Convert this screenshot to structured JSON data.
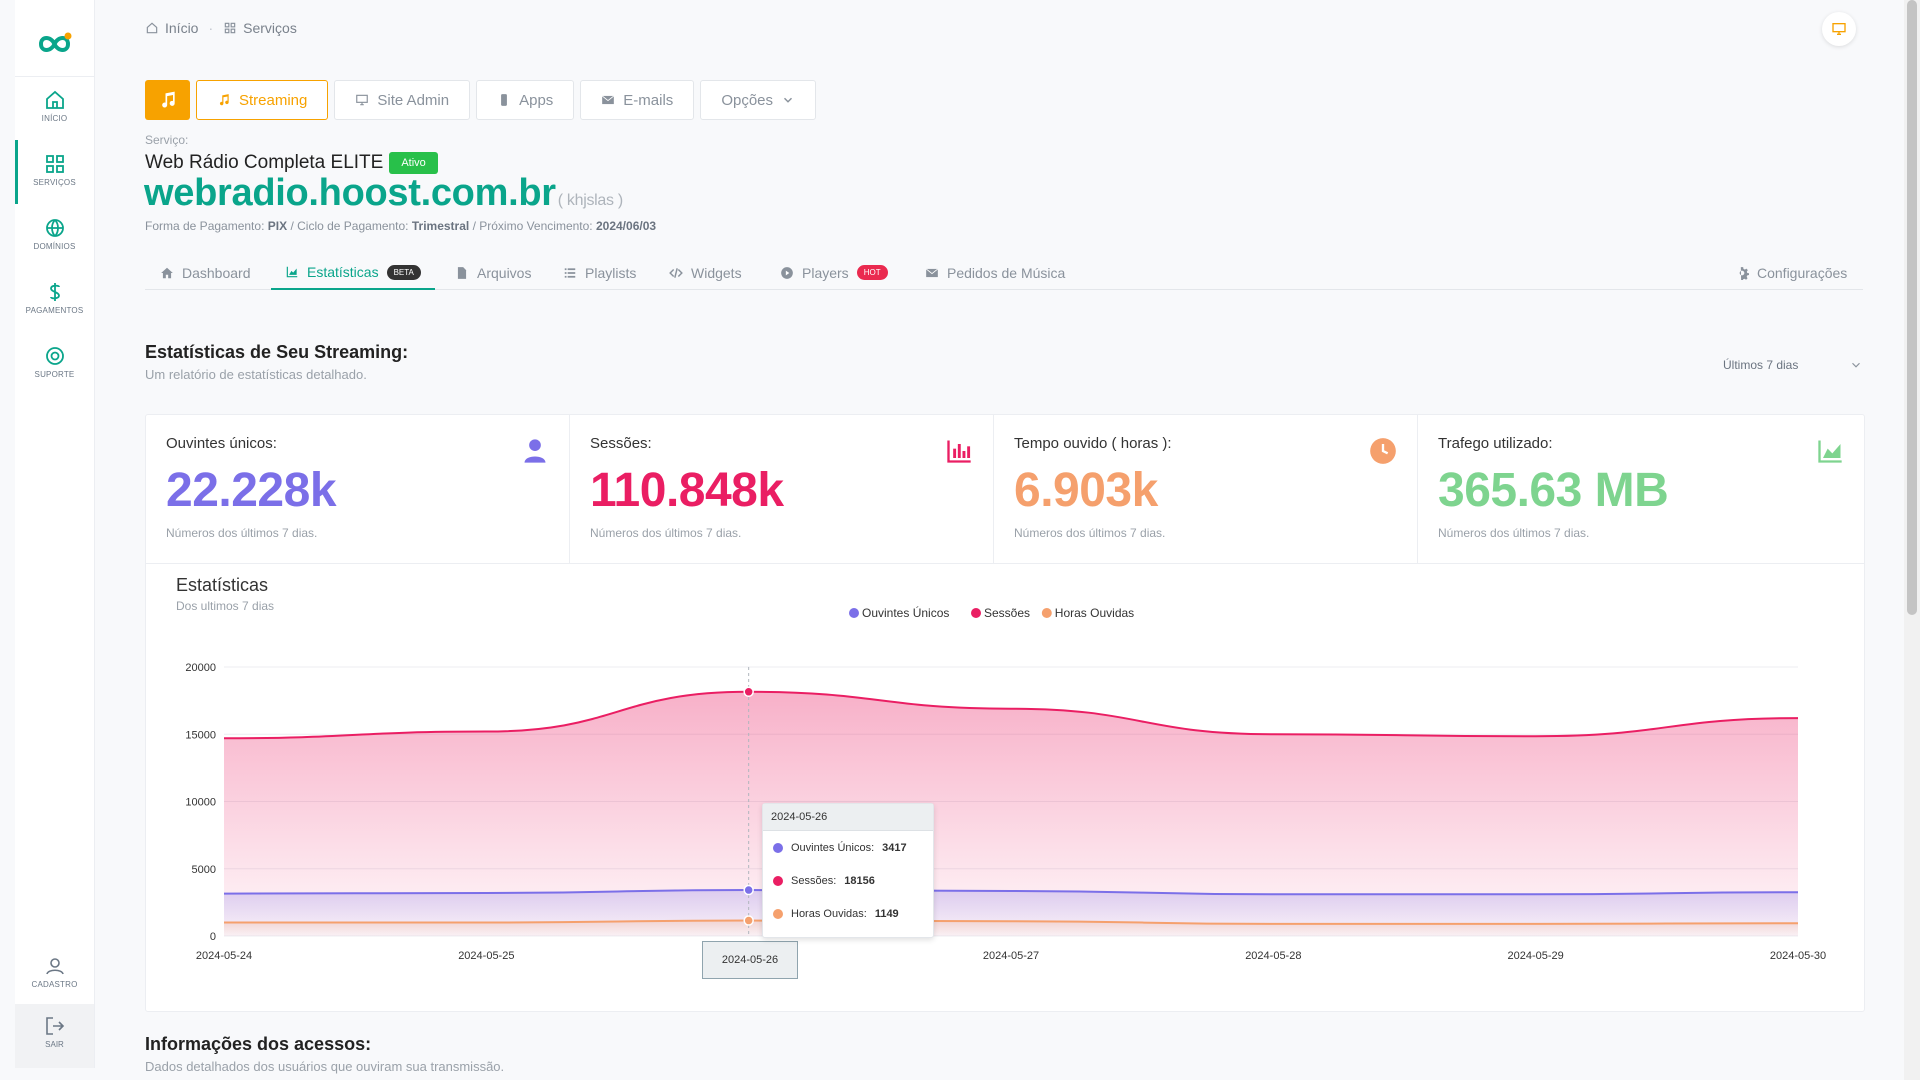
{
  "sidebar": {
    "items": [
      {
        "label": "INÍCIO",
        "icon": "home-icon"
      },
      {
        "label": "SERVIÇOS",
        "icon": "grid-icon",
        "active": true
      },
      {
        "label": "DOMÍNIOS",
        "icon": "globe-icon"
      },
      {
        "label": "PAGAMENTOS",
        "icon": "dollar-icon"
      },
      {
        "label": "SUPORTE",
        "icon": "lifebuoy-icon"
      }
    ],
    "cadastro_label": "CADASTRO",
    "sair_label": "SAIR"
  },
  "breadcrumb": {
    "home": "Início",
    "current": "Serviços"
  },
  "service_tabs": {
    "streaming": "Streaming",
    "site_admin": "Site Admin",
    "apps": "Apps",
    "emails": "E-mails",
    "opcoes": "Opções"
  },
  "service": {
    "label": "Serviço:",
    "name": "Web Rádio Completa ELITE",
    "status": "Ativo",
    "domain": "webradio.hoost.com.br",
    "username": "( khjslas )",
    "payment_label": "Forma de Pagamento:",
    "payment_value": "PIX",
    "cycle_label": "/ Ciclo de Pagamento:",
    "cycle_value": "Trimestral",
    "due_label": "/ Próximo Vencimento:",
    "due_value": "2024/06/03"
  },
  "sub_tabs": {
    "dashboard": "Dashboard",
    "estatisticas": "Estatísticas",
    "beta": "BETA",
    "arquivos": "Arquivos",
    "playlists": "Playlists",
    "widgets": "Widgets",
    "players": "Players",
    "hot": "HOT",
    "pedidos": "Pedidos de Música",
    "configuracoes": "Configurações"
  },
  "stats": {
    "title": "Estatísticas de Seu Streaming:",
    "subtitle": "Um relatório de estatísticas detalhado.",
    "period": "Últimos 7 dias"
  },
  "kpis": [
    {
      "title": "Ouvintes únicos:",
      "value": "22.228k",
      "note": "Números dos últimos 7 dias.",
      "color": "#7b6fe8",
      "icon": "user-icon"
    },
    {
      "title": "Sessões:",
      "value": "110.848k",
      "note": "Números dos últimos 7 dias.",
      "color": "#ea1e63",
      "icon": "bar-chart-icon"
    },
    {
      "title": "Tempo ouvido ( horas ):",
      "value": "6.903k",
      "note": "Números dos últimos 7 dias.",
      "color": "#f5a06d",
      "icon": "clock-icon"
    },
    {
      "title": "Trafego utilizado:",
      "value": "365.63 MB",
      "note": "Números dos últimos 7 dias.",
      "color": "#7ed48f",
      "icon": "area-chart-icon"
    }
  ],
  "chart_header": {
    "title": "Estatísticas",
    "subtitle": "Dos ultimos 7 dias"
  },
  "chart_data": {
    "type": "area",
    "x": [
      "2024-05-24",
      "2024-05-25",
      "2024-05-26",
      "2024-05-27",
      "2024-05-28",
      "2024-05-29",
      "2024-05-30"
    ],
    "series": [
      {
        "name": "Ouvintes Únicos",
        "color": "#7b6fe8",
        "values": [
          3150,
          3200,
          3417,
          3350,
          3100,
          3100,
          3250
        ]
      },
      {
        "name": "Sessões",
        "color": "#ea1e63",
        "values": [
          14700,
          15200,
          18156,
          16900,
          15000,
          14850,
          16200
        ]
      },
      {
        "name": "Horas Ouvidas",
        "color": "#f5a06d",
        "values": [
          1000,
          1000,
          1149,
          1100,
          900,
          900,
          950
        ]
      }
    ],
    "yticks": [
      0,
      5000,
      10000,
      15000,
      20000
    ],
    "ylim": [
      0,
      20000
    ],
    "legend": "top-center",
    "tooltip": {
      "date": "2024-05-26",
      "rows": [
        {
          "label": "Ouvintes Únicos:",
          "value": "3417"
        },
        {
          "label": "Sessões:",
          "value": "18156"
        },
        {
          "label": "Horas Ouvidas:",
          "value": "1149"
        }
      ]
    }
  },
  "access_info": {
    "title": "Informações dos acessos:",
    "subtitle": "Dados detalhados dos usuários que ouviram sua transmissão."
  },
  "colors": {
    "brand": "#0aa58b",
    "accent": "#f7a200"
  }
}
